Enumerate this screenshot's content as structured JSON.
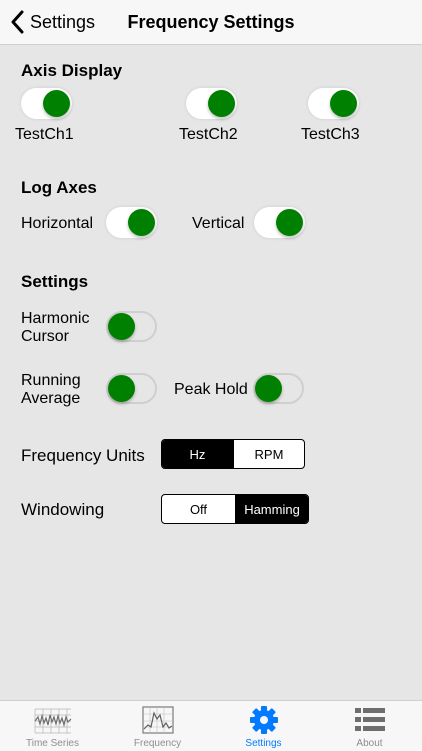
{
  "nav": {
    "back_label": "Settings",
    "title": "Frequency Settings"
  },
  "axis_display": {
    "title": "Axis Display",
    "channels": [
      {
        "label": "TestCh1",
        "on": true
      },
      {
        "label": "TestCh2",
        "on": true
      },
      {
        "label": "TestCh3",
        "on": true
      }
    ]
  },
  "log_axes": {
    "title": "Log Axes",
    "horizontal_label": "Horizontal",
    "horizontal_on": true,
    "vertical_label": "Vertical",
    "vertical_on": true
  },
  "settings": {
    "title": "Settings",
    "harmonic_cursor_line1": "Harmonic",
    "harmonic_cursor_line2": "Cursor",
    "harmonic_cursor_on": false,
    "running_average_line1": "Running",
    "running_average_line2": "Average",
    "running_average_on": false,
    "peak_hold_label": "Peak Hold",
    "peak_hold_on": false
  },
  "frequency_units": {
    "label": "Frequency Units",
    "options": [
      "Hz",
      "RPM"
    ],
    "selected": "Hz"
  },
  "windowing": {
    "label": "Windowing",
    "options": [
      "Off",
      "Hamming"
    ],
    "selected": "Hamming"
  },
  "tabs": [
    {
      "label": "Time Series",
      "icon": "time-series-icon"
    },
    {
      "label": "Frequency",
      "icon": "frequency-icon"
    },
    {
      "label": "Settings",
      "icon": "gear-icon",
      "active": true
    },
    {
      "label": "About",
      "icon": "list-icon"
    }
  ],
  "colors": {
    "toggle_knob": "#008000",
    "active_tab": "#007aff",
    "background": "#e6e6e6"
  }
}
